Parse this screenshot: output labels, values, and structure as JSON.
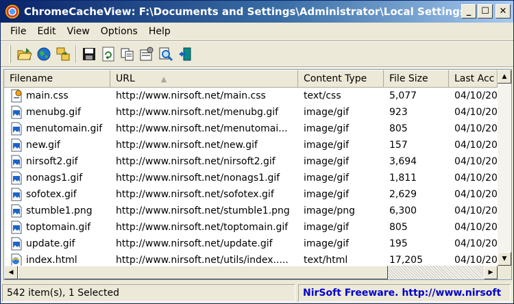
{
  "window": {
    "title": "ChromeCacheView:  F:\\Documents and Settings\\Administrator\\Local Settings...",
    "minimize_glyph": "_",
    "maximize_glyph": "☐",
    "close_glyph": "✕"
  },
  "menu": {
    "items": [
      {
        "label": "File"
      },
      {
        "label": "Edit"
      },
      {
        "label": "View"
      },
      {
        "label": "Options"
      },
      {
        "label": "Help"
      }
    ]
  },
  "toolbar": {
    "icons": [
      "open-folder-icon",
      "globe-icon",
      "copy-files-icon",
      "save-icon",
      "refresh-icon",
      "copy-icon",
      "properties-icon",
      "find-icon",
      "exit-icon"
    ]
  },
  "columns": {
    "filename": "Filename",
    "url": "URL",
    "content_type": "Content Type",
    "file_size": "File Size",
    "last_accessed": "Last Acc",
    "sort_indicator": "▲"
  },
  "rows": [
    {
      "filename": "main.css",
      "url": "http://www.nirsoft.net/main.css",
      "type": "text/css",
      "size": "5,077",
      "date": "04/10/20",
      "icon": "css-file-icon"
    },
    {
      "filename": "menubg.gif",
      "url": "http://www.nirsoft.net/menubg.gif",
      "type": "image/gif",
      "size": "923",
      "date": "04/10/20",
      "icon": "image-file-icon"
    },
    {
      "filename": "menutomain.gif",
      "url": "http://www.nirsoft.net/menutomai...",
      "type": "image/gif",
      "size": "805",
      "date": "04/10/20",
      "icon": "image-file-icon"
    },
    {
      "filename": "new.gif",
      "url": "http://www.nirsoft.net/new.gif",
      "type": "image/gif",
      "size": "157",
      "date": "04/10/20",
      "icon": "image-file-icon"
    },
    {
      "filename": "nirsoft2.gif",
      "url": "http://www.nirsoft.net/nirsoft2.gif",
      "type": "image/gif",
      "size": "3,694",
      "date": "04/10/20",
      "icon": "image-file-icon"
    },
    {
      "filename": "nonags1.gif",
      "url": "http://www.nirsoft.net/nonags1.gif",
      "type": "image/gif",
      "size": "1,811",
      "date": "04/10/20",
      "icon": "image-file-icon"
    },
    {
      "filename": "sofotex.gif",
      "url": "http://www.nirsoft.net/sofotex.gif",
      "type": "image/gif",
      "size": "2,629",
      "date": "04/10/20",
      "icon": "image-file-icon"
    },
    {
      "filename": "stumble1.png",
      "url": "http://www.nirsoft.net/stumble1.png",
      "type": "image/png",
      "size": "6,300",
      "date": "04/10/20",
      "icon": "image-file-icon"
    },
    {
      "filename": "toptomain.gif",
      "url": "http://www.nirsoft.net/toptomain.gif",
      "type": "image/gif",
      "size": "805",
      "date": "04/10/20",
      "icon": "image-file-icon"
    },
    {
      "filename": "update.gif",
      "url": "http://www.nirsoft.net/update.gif",
      "type": "image/gif",
      "size": "195",
      "date": "04/10/20",
      "icon": "image-file-icon"
    },
    {
      "filename": "index.html",
      "url": "http://www.nirsoft.net/utils/index.....",
      "type": "text/html",
      "size": "17,205",
      "date": "04/10/20",
      "icon": "html-file-icon"
    }
  ],
  "status": {
    "count": "542 item(s), 1 Selected",
    "credit": "NirSoft Freeware.  http://www.nirsoft"
  }
}
